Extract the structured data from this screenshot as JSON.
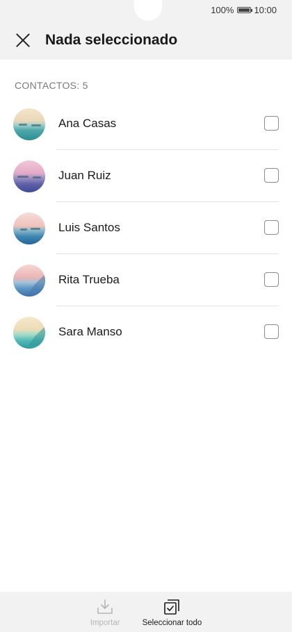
{
  "status_bar": {
    "battery_percent": "100%",
    "battery_icon": "battery-full-icon",
    "time": "10:00"
  },
  "header": {
    "close_icon": "close-icon",
    "title": "Nada seleccionado"
  },
  "contacts_section": {
    "label": "CONTACTOS: 5",
    "items": [
      {
        "name": "Ana Casas",
        "selected": false,
        "avatar": "landscape-teal"
      },
      {
        "name": "Juan Ruiz",
        "selected": false,
        "avatar": "landscape-purple"
      },
      {
        "name": "Luis Santos",
        "selected": false,
        "avatar": "landscape-blue"
      },
      {
        "name": "Rita Trueba",
        "selected": false,
        "avatar": "landscape-pink-blue"
      },
      {
        "name": "Sara Manso",
        "selected": false,
        "avatar": "landscape-turquoise"
      }
    ]
  },
  "bottom_bar": {
    "import": {
      "label": "Importar",
      "icon": "import-icon",
      "enabled": false
    },
    "select_all": {
      "label": "Seleccionar todo",
      "icon": "select-all-icon",
      "enabled": true
    }
  },
  "colors": {
    "bar_background": "#f2f2f2",
    "disabled": "#b5b5b5",
    "divider": "#e3e3e3"
  }
}
